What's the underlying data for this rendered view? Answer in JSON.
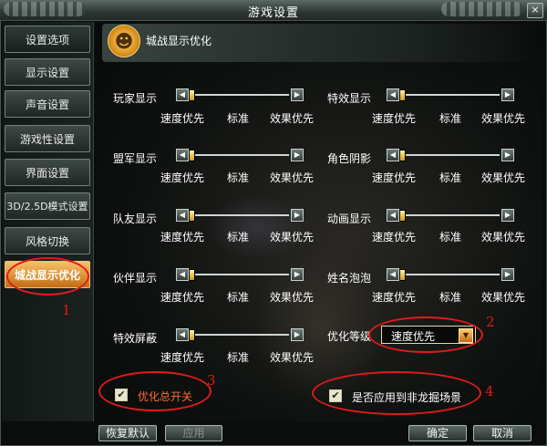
{
  "window": {
    "title": "游戏设置",
    "close": "×"
  },
  "sidebar": {
    "items": [
      {
        "label": "设置选项"
      },
      {
        "label": "显示设置"
      },
      {
        "label": "声音设置"
      },
      {
        "label": "游戏性设置"
      },
      {
        "label": "界面设置"
      },
      {
        "label": "3D/2.5D模式设置"
      },
      {
        "label": "风格切换"
      },
      {
        "label": "城战显示优化",
        "active": true
      }
    ]
  },
  "panel": {
    "title": "城战显示优化",
    "icon": "people-icon"
  },
  "scale_labels": {
    "left": "速度优先",
    "mid": "标准",
    "right": "效果优先"
  },
  "sliders": {
    "player": {
      "label": "玩家显示",
      "level": 0
    },
    "effect": {
      "label": "特效显示",
      "level": 0
    },
    "ally": {
      "label": "盟军显示",
      "level": 0
    },
    "shadow": {
      "label": "角色阴影",
      "level": 0
    },
    "team": {
      "label": "队友显示",
      "level": 0
    },
    "anim": {
      "label": "动画显示",
      "level": 0
    },
    "partner": {
      "label": "伙伴显示",
      "level": 0
    },
    "name": {
      "label": "姓名泡泡",
      "level": 0
    },
    "shield": {
      "label": "特效屏蔽",
      "level": 0
    }
  },
  "quality": {
    "label": "优化等级",
    "value": "速度优先"
  },
  "checkboxes": {
    "master": {
      "label": "优化总开关",
      "checked": true
    },
    "apply": {
      "label": "是否应用到非龙掘场景",
      "checked": true
    }
  },
  "buttons": {
    "reset": "恢复默认",
    "apply": "应用",
    "ok": "确定",
    "cancel": "取消"
  },
  "annotations": [
    "1",
    "2",
    "3",
    "4"
  ],
  "colors": {
    "annotation": "#e11b1b",
    "accent": "#e8901c"
  }
}
